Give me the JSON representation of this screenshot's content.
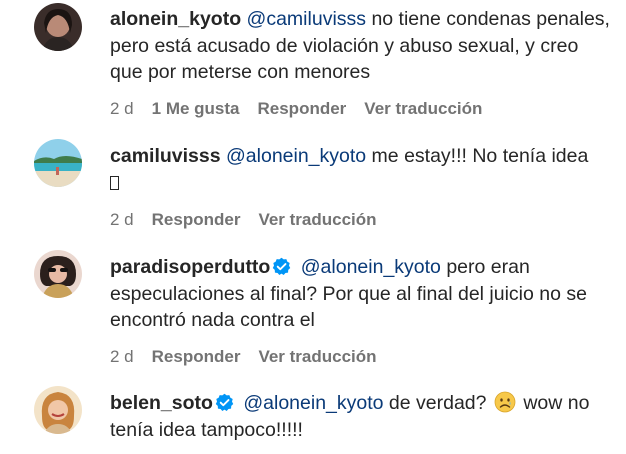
{
  "comments": [
    {
      "username": "alonein_kyoto",
      "verified": false,
      "mention": "@camiluvisss",
      "body": " no tiene condenas penales, pero está acusado de violación y abuso sexual, y creo que por meterse con menores",
      "time": "2 d",
      "likes": "1 Me gusta",
      "reply": "Responder",
      "translate": "Ver traducción"
    },
    {
      "username": "camiluvisss",
      "verified": false,
      "mention": "@alonein_kyoto",
      "body": " me estay!!! No tenía idea",
      "trailing_glyph": "unsupported-emoji-box",
      "time": "2 d",
      "reply": "Responder",
      "translate": "Ver traducción"
    },
    {
      "username": "paradisoperdutto",
      "verified": true,
      "mention": "@alonein_kyoto",
      "body": " pero eran especulaciones al final? Por que al final del juicio no se encontró nada contra el",
      "time": "2 d",
      "reply": "Responder",
      "translate": "Ver traducción"
    },
    {
      "username": "belen_soto",
      "verified": true,
      "mention": "@alonein_kyoto",
      "body_before_emoji": " de verdad? ",
      "emoji": "sad-face-emoji",
      "body_after_emoji": " wow no tenía idea tampoco!!!!!"
    }
  ],
  "colors": {
    "text": "#262626",
    "mention": "#0a3a78",
    "meta": "#737373",
    "verified": "#0095f6"
  }
}
